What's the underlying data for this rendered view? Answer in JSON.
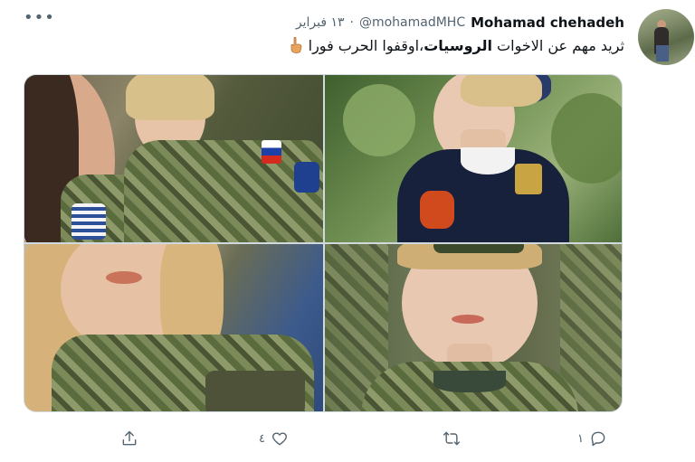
{
  "tweet": {
    "display_name": "Mohamad chehadeh",
    "handle": "@mohamadMHC",
    "separator": "·",
    "date": "١٣ فبراير",
    "text_part1": "ثريد مهم عن الاخوات ",
    "text_bold": "الروسيات",
    "text_part2": "،اوقفوا الحرب فورا"
  },
  "icons": {
    "more": "more-icon",
    "reply": "reply-icon",
    "retweet": "retweet-icon",
    "like": "heart-icon",
    "share": "share-icon",
    "hand": "point-down-hand-emoji"
  },
  "counts": {
    "replies": "١",
    "retweets": "",
    "likes": "٤"
  },
  "colors": {
    "text": "#0f1419",
    "secondary": "#536471",
    "border": "#cfd9de"
  }
}
